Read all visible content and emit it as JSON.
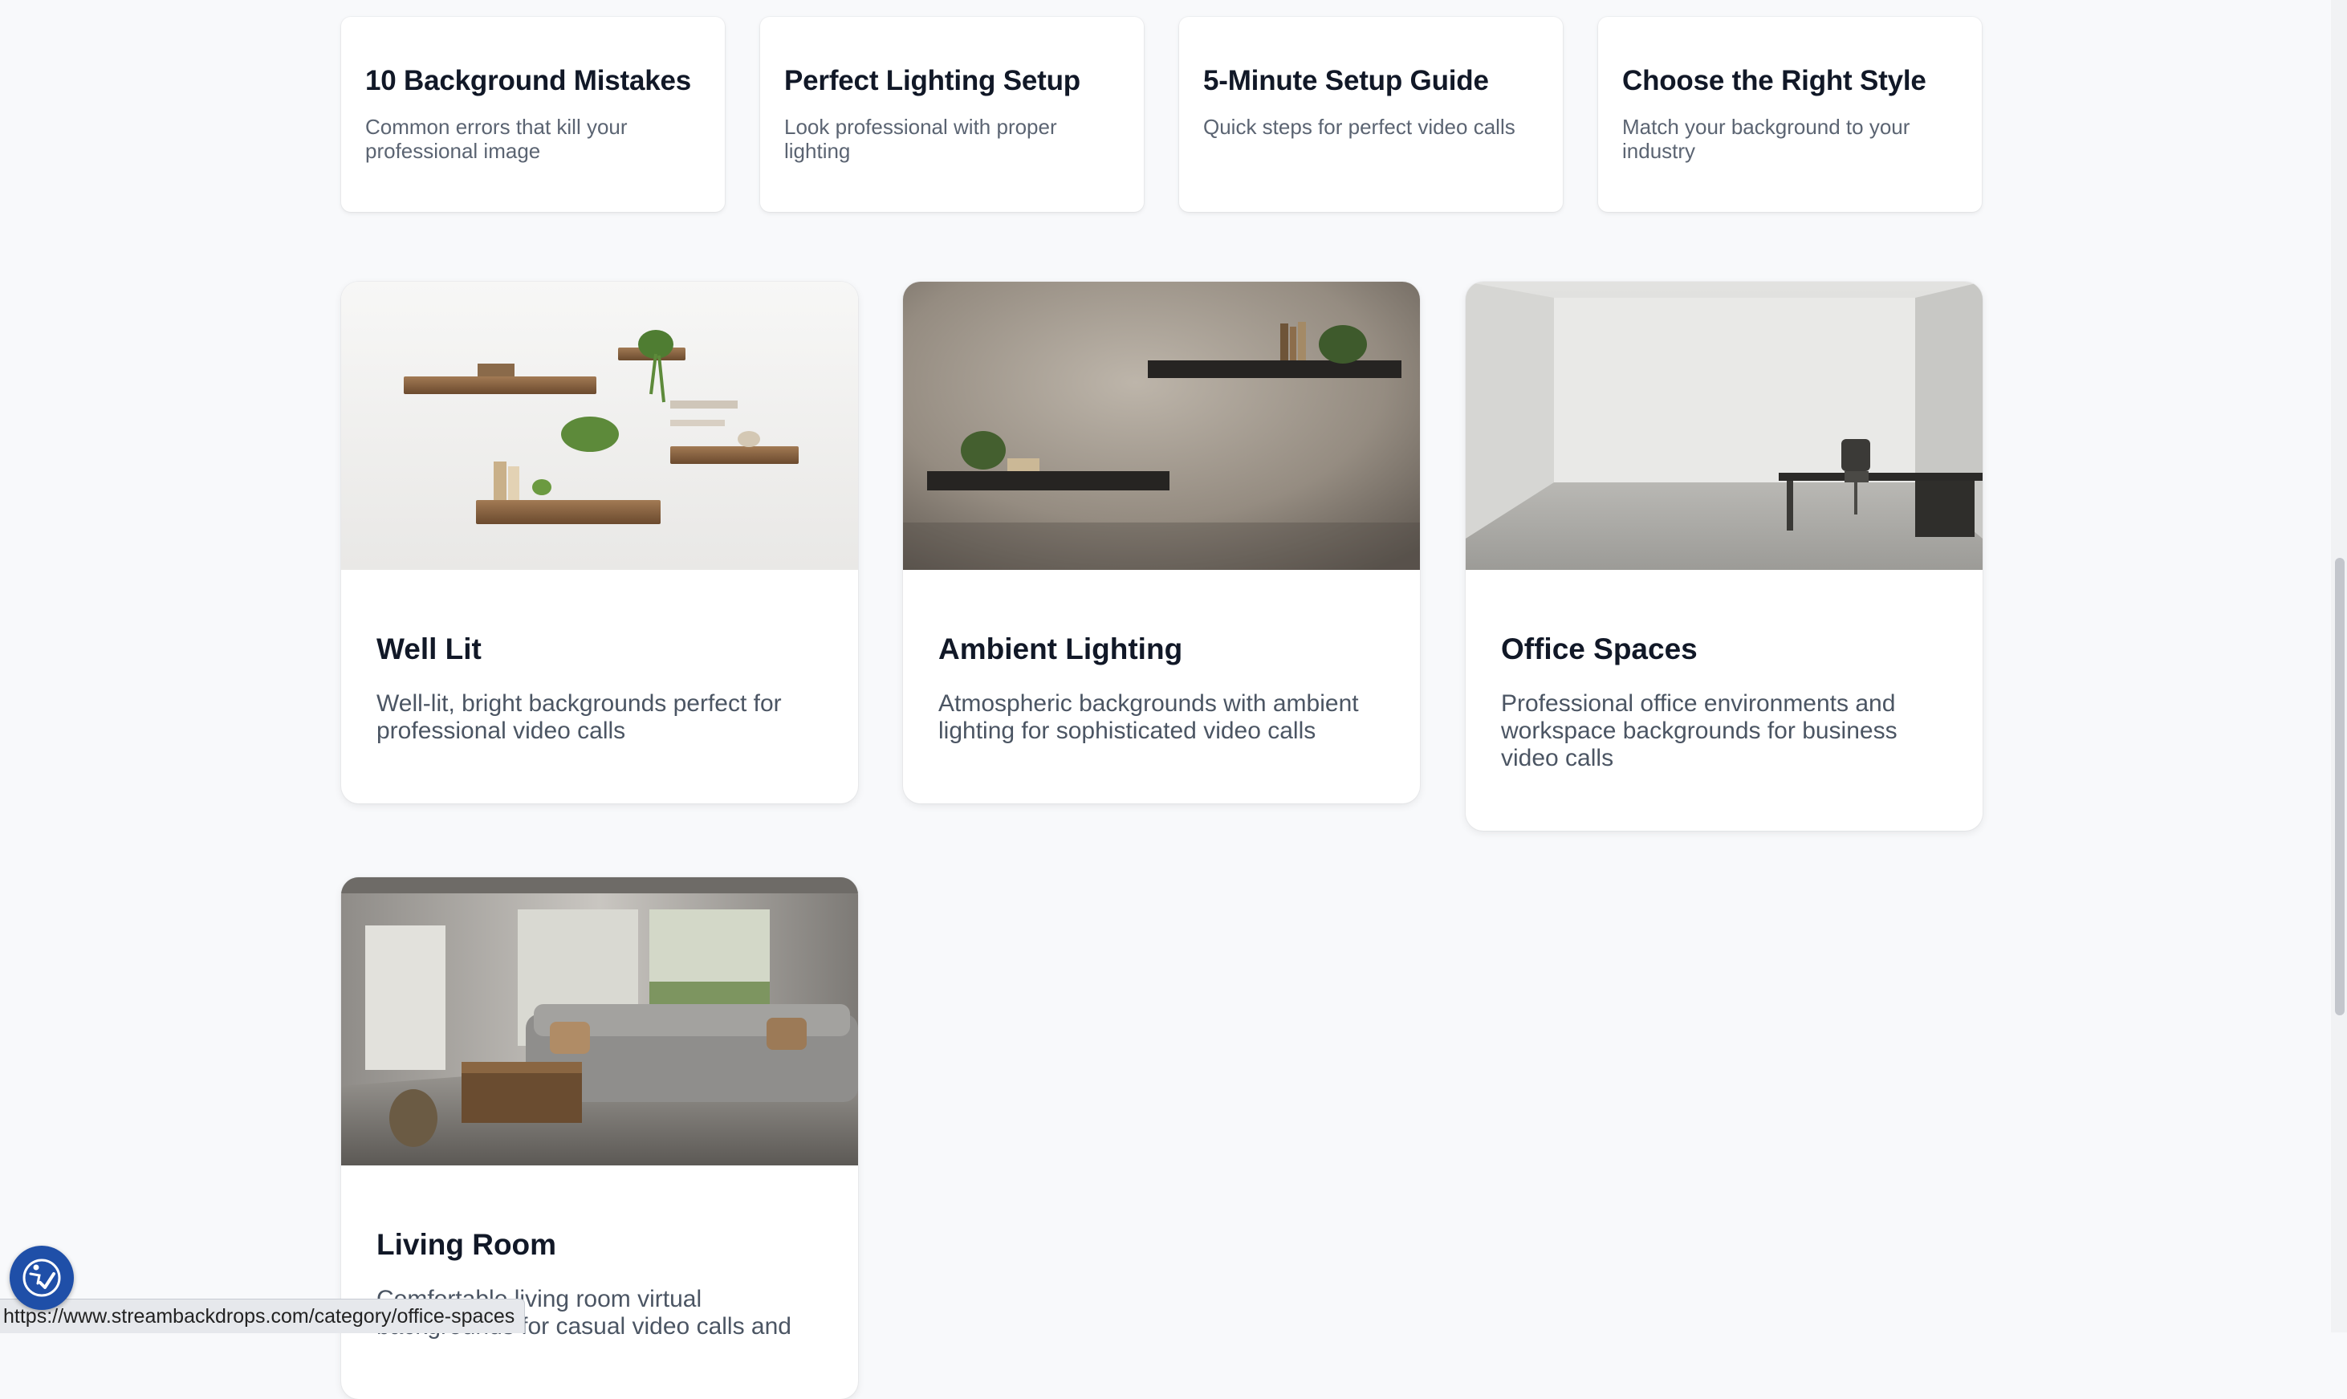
{
  "guides": [
    {
      "title": "10 Background Mistakes",
      "desc": "Common errors that kill your professional image"
    },
    {
      "title": "Perfect Lighting Setup",
      "desc": "Look professional with proper lighting"
    },
    {
      "title": "5-Minute Setup Guide",
      "desc": "Quick steps for perfect video calls"
    },
    {
      "title": "Choose the Right Style",
      "desc": "Match your background to your industry"
    }
  ],
  "categories": [
    {
      "title": "Well Lit",
      "desc": "Well-lit, bright backgrounds perfect for professional video calls",
      "image": "floating-wood-shelves-white-wall"
    },
    {
      "title": "Ambient Lighting",
      "desc": "Atmospheric backgrounds with ambient lighting for sophisticated video calls",
      "image": "dark-shelves-plaster-wall"
    },
    {
      "title": "Office Spaces",
      "desc": "Professional office environments and workspace backgrounds for business video calls",
      "image": "minimal-office-desk-room"
    },
    {
      "title": "Living Room",
      "desc": "Comfortable living room virtual backgrounds for casual video calls and",
      "image": "rustic-living-room-sofa"
    }
  ],
  "status_url": "https://www.streambackdrops.com/category/office-spaces",
  "accessibility_icon": "accessibility-check-icon"
}
